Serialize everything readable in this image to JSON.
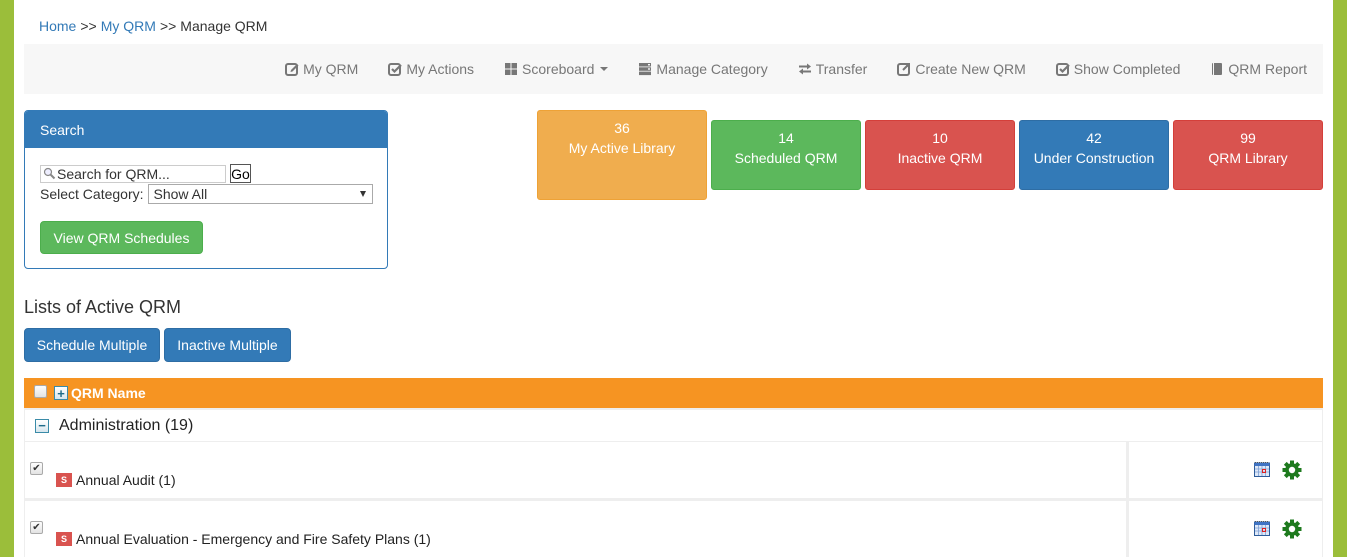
{
  "breadcrumb": {
    "items": [
      {
        "label": "Home",
        "link": true
      },
      {
        "label": "My QRM",
        "link": true
      },
      {
        "label": "Manage QRM",
        "link": false
      }
    ],
    "separator": ">>"
  },
  "toolbar": {
    "items": [
      {
        "label": "My QRM",
        "icon": "edit-icon"
      },
      {
        "label": "My Actions",
        "icon": "check-square-icon"
      },
      {
        "label": "Scoreboard",
        "icon": "grid-icon",
        "dropdown": true
      },
      {
        "label": "Manage Category",
        "icon": "server-icon"
      },
      {
        "label": "Transfer",
        "icon": "transfer-icon"
      },
      {
        "label": "Create New QRM",
        "icon": "external-link-icon"
      },
      {
        "label": "Show Completed",
        "icon": "check-square-icon"
      },
      {
        "label": "QRM Report",
        "icon": "book-icon"
      }
    ]
  },
  "search": {
    "title": "Search",
    "placeholder": "Search for QRM...",
    "go_label": "Go",
    "category_label": "Select Category:",
    "category_value": "Show All",
    "view_schedules_label": "View QRM Schedules"
  },
  "stats": [
    {
      "count": "36",
      "label": "My Active Library",
      "color": "#f0ad4e"
    },
    {
      "count": "14",
      "label": "Scheduled QRM",
      "color": "#5cb85c"
    },
    {
      "count": "10",
      "label": "Inactive QRM",
      "color": "#d9534f"
    },
    {
      "count": "42",
      "label": "Under Construction",
      "color": "#337ab7"
    },
    {
      "count": "99",
      "label": "QRM Library",
      "color": "#d9534f"
    }
  ],
  "list": {
    "title": "Lists of Active QRM",
    "schedule_multiple_label": "Schedule Multiple",
    "inactive_multiple_label": "Inactive Multiple",
    "header": "QRM Name",
    "header_color": "#f69422",
    "group": {
      "label": "Administration (19)"
    },
    "items": [
      {
        "badge": "S",
        "name": "Annual Audit (1)",
        "checked": true
      },
      {
        "badge": "S",
        "name": "Annual Evaluation - Emergency and Fire Safety Plans (1)",
        "checked": true
      }
    ]
  }
}
